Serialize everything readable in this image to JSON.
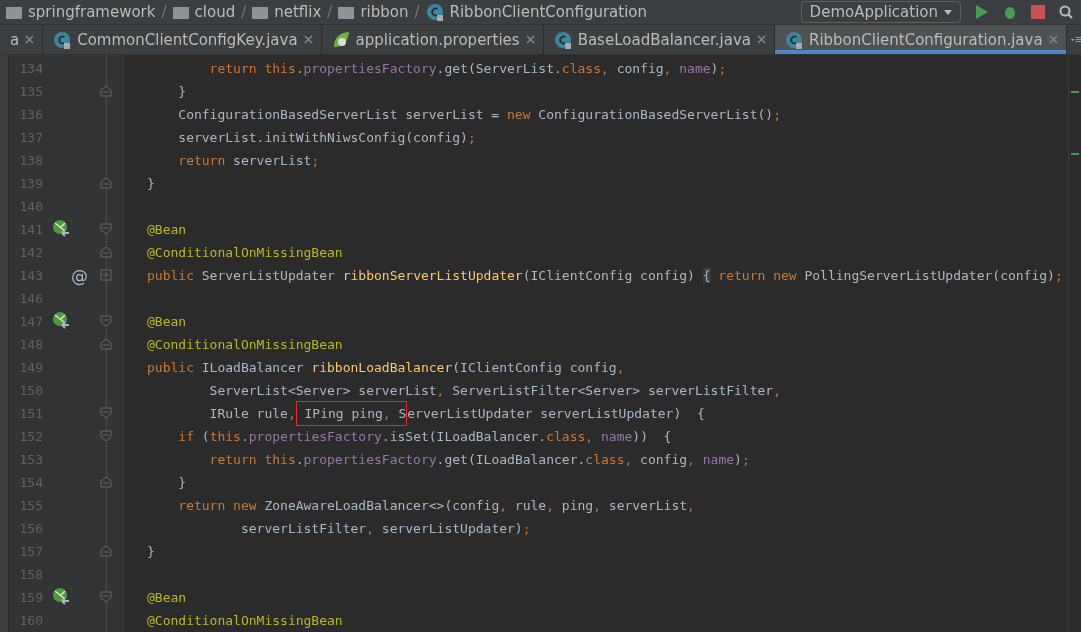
{
  "breadcrumbs": [
    {
      "label": "springframework",
      "kind": "folder"
    },
    {
      "label": "cloud",
      "kind": "folder",
      "separator": "/"
    },
    {
      "label": "netflix",
      "kind": "folder",
      "separator": "/"
    },
    {
      "label": "ribbon",
      "kind": "folder",
      "separator": "/"
    },
    {
      "label": "RibbonClientConfiguration",
      "kind": "class",
      "separator": "/"
    }
  ],
  "run_config": {
    "label": "DemoApplication"
  },
  "tabs": [
    {
      "label": "a",
      "kind": "none",
      "selected": false
    },
    {
      "label": "CommonClientConfigKey.java",
      "kind": "class",
      "selected": false
    },
    {
      "label": "application.properties",
      "kind": "spring",
      "selected": false
    },
    {
      "label": "BaseLoadBalancer.java",
      "kind": "class",
      "selected": false
    },
    {
      "label": "RibbonClientConfiguration.java",
      "kind": "class",
      "selected": true
    }
  ],
  "lines": [
    {
      "number": "134",
      "tokens": [
        {
          "kind": "keyword",
          "text": "        return this"
        },
        {
          "kind": "plain",
          "text": "."
        },
        {
          "kind": "field",
          "text": "propertiesFactory"
        },
        {
          "kind": "plain",
          "text": ".get(ServerList."
        },
        {
          "kind": "keyword",
          "text": "class,"
        },
        {
          "kind": "plain",
          "text": " config"
        },
        {
          "kind": "keyword",
          "text": ","
        },
        {
          "kind": "field",
          "text": " name"
        },
        {
          "kind": "plain",
          "text": ")"
        },
        {
          "kind": "keyword",
          "text": ";"
        }
      ]
    },
    {
      "number": "135",
      "fold": {
        "kind": "end"
      },
      "tokens": [
        {
          "kind": "plain",
          "text": "    }"
        }
      ]
    },
    {
      "number": "136",
      "tokens": [
        {
          "kind": "plain",
          "text": "    ConfigurationBasedServerList serverList = "
        },
        {
          "kind": "keyword",
          "text": "new"
        },
        {
          "kind": "plain",
          "text": " ConfigurationBasedServerList()"
        },
        {
          "kind": "keyword",
          "text": ";"
        }
      ]
    },
    {
      "number": "137",
      "tokens": [
        {
          "kind": "plain",
          "text": "    serverList.initWithNiwsConfig(config)"
        },
        {
          "kind": "keyword",
          "text": ";"
        }
      ]
    },
    {
      "number": "138",
      "tokens": [
        {
          "kind": "keyword",
          "text": "    return"
        },
        {
          "kind": "plain",
          "text": " serverList"
        },
        {
          "kind": "keyword",
          "text": ";"
        }
      ]
    },
    {
      "number": "139",
      "fold": {
        "kind": "end"
      },
      "tokens": [
        {
          "kind": "plain",
          "text": "}"
        }
      ]
    },
    {
      "number": "140"
    },
    {
      "number": "141",
      "gutter": {
        "kind": "bean"
      },
      "fold": {
        "kind": "start"
      },
      "tokens": [
        {
          "kind": "annotation",
          "text": "@Bean"
        }
      ]
    },
    {
      "number": "142",
      "fold": {
        "kind": "end"
      },
      "tokens": [
        {
          "kind": "annotation",
          "text": "@ConditionalOnMissingBean"
        }
      ]
    },
    {
      "number": "143",
      "gutter": {
        "kind": "at",
        "text": "@"
      },
      "fold": {
        "kind": "collapsed"
      },
      "tokens": [
        {
          "kind": "keyword",
          "text": "public"
        },
        {
          "kind": "plain",
          "text": " ServerListUpdater "
        },
        {
          "kind": "method",
          "text": "ribbonServerListUpdater"
        },
        {
          "kind": "plain",
          "text": "(IClientConfig config) "
        },
        {
          "kind": "folded",
          "text": "{"
        },
        {
          "kind": "keyword",
          "text": " return new"
        },
        {
          "kind": "plain",
          "text": " PollingServerListUpdater(config)"
        },
        {
          "kind": "keyword",
          "text": ";"
        }
      ]
    },
    {
      "number": "146"
    },
    {
      "number": "147",
      "gutter": {
        "kind": "bean"
      },
      "fold": {
        "kind": "start"
      },
      "tokens": [
        {
          "kind": "annotation",
          "text": "@Bean"
        }
      ]
    },
    {
      "number": "148",
      "fold": {
        "kind": "end"
      },
      "tokens": [
        {
          "kind": "annotation",
          "text": "@ConditionalOnMissingBean"
        }
      ]
    },
    {
      "number": "149",
      "tokens": [
        {
          "kind": "keyword",
          "text": "public"
        },
        {
          "kind": "plain",
          "text": " ILoadBalancer "
        },
        {
          "kind": "method",
          "text": "ribbonLoadBalancer"
        },
        {
          "kind": "plain",
          "text": "(IClientConfig config"
        },
        {
          "kind": "keyword",
          "text": ","
        }
      ]
    },
    {
      "number": "150",
      "tokens": [
        {
          "kind": "plain",
          "text": "        ServerList"
        },
        {
          "kind": "generic",
          "text": "<Server>"
        },
        {
          "kind": "plain",
          "text": " serverList"
        },
        {
          "kind": "keyword",
          "text": ","
        },
        {
          "kind": "plain",
          "text": " ServerListFilter"
        },
        {
          "kind": "generic",
          "text": "<Server>"
        },
        {
          "kind": "plain",
          "text": " serverListFilter"
        },
        {
          "kind": "keyword",
          "text": ","
        }
      ]
    },
    {
      "number": "151",
      "fold": {
        "kind": "start"
      },
      "tokens": [
        {
          "kind": "plain",
          "text": "        IRule rule"
        },
        {
          "kind": "keyword",
          "text": ","
        },
        {
          "kind": "boxed",
          "children": [
            {
              "kind": "plain",
              "text": " IPing ping"
            },
            {
              "kind": "keyword",
              "text": ","
            },
            {
              "kind": "plain",
              "text": " S"
            }
          ]
        },
        {
          "kind": "plain",
          "text": "erverListUpdater serverListUpdater)  {"
        }
      ]
    },
    {
      "number": "152",
      "fold": {
        "kind": "start"
      },
      "tokens": [
        {
          "kind": "keyword",
          "text": "    if"
        },
        {
          "kind": "plain",
          "text": " ("
        },
        {
          "kind": "keyword",
          "text": "this"
        },
        {
          "kind": "plain",
          "text": "."
        },
        {
          "kind": "field",
          "text": "propertiesFactory"
        },
        {
          "kind": "plain",
          "text": ".isSet(ILoadBalancer."
        },
        {
          "kind": "keyword",
          "text": "class,"
        },
        {
          "kind": "field",
          "text": " name"
        },
        {
          "kind": "plain",
          "text": "))  {"
        }
      ]
    },
    {
      "number": "153",
      "tokens": [
        {
          "kind": "keyword",
          "text": "        return this"
        },
        {
          "kind": "plain",
          "text": "."
        },
        {
          "kind": "field",
          "text": "propertiesFactory"
        },
        {
          "kind": "plain",
          "text": ".get(ILoadBalancer."
        },
        {
          "kind": "keyword",
          "text": "class,"
        },
        {
          "kind": "plain",
          "text": " config"
        },
        {
          "kind": "keyword",
          "text": ","
        },
        {
          "kind": "field",
          "text": " name"
        },
        {
          "kind": "plain",
          "text": ")"
        },
        {
          "kind": "keyword",
          "text": ";"
        }
      ]
    },
    {
      "number": "154",
      "fold": {
        "kind": "end"
      },
      "tokens": [
        {
          "kind": "plain",
          "text": "    }"
        }
      ]
    },
    {
      "number": "155",
      "tokens": [
        {
          "kind": "keyword",
          "text": "    return new"
        },
        {
          "kind": "plain",
          "text": " ZoneAwareLoadBalancer<>(config"
        },
        {
          "kind": "keyword",
          "text": ","
        },
        {
          "kind": "plain",
          "text": " rule"
        },
        {
          "kind": "keyword",
          "text": ","
        },
        {
          "kind": "plain",
          "text": " ping"
        },
        {
          "kind": "keyword",
          "text": ","
        },
        {
          "kind": "plain",
          "text": " serverList"
        },
        {
          "kind": "keyword",
          "text": ","
        }
      ]
    },
    {
      "number": "156",
      "tokens": [
        {
          "kind": "plain",
          "text": "            serverListFilter"
        },
        {
          "kind": "keyword",
          "text": ","
        },
        {
          "kind": "plain",
          "text": " serverListUpdater)"
        },
        {
          "kind": "keyword",
          "text": ";"
        }
      ]
    },
    {
      "number": "157",
      "fold": {
        "kind": "end"
      },
      "tokens": [
        {
          "kind": "plain",
          "text": "}"
        }
      ]
    },
    {
      "number": "158"
    },
    {
      "number": "159",
      "gutter": {
        "kind": "bean"
      },
      "fold": {
        "kind": "start"
      },
      "tokens": [
        {
          "kind": "annotation",
          "text": "@Bean"
        }
      ]
    },
    {
      "number": "160",
      "tokens": [
        {
          "kind": "annotation",
          "text": "@ConditionalOnMissingBean"
        }
      ]
    }
  ]
}
